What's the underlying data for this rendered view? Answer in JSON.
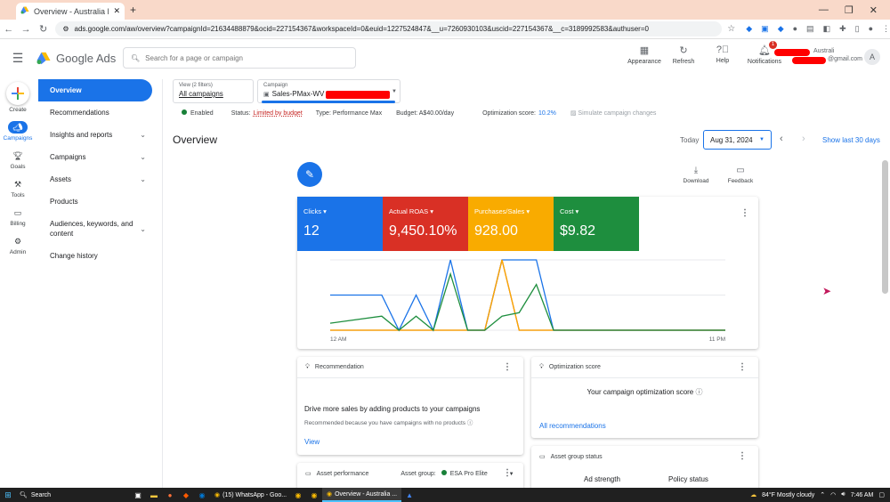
{
  "browser": {
    "tab_title": "Overview - Australia Hoverbo…",
    "url": "ads.google.com/aw/overview?campaignId=21634488879&ocid=227154367&workspaceId=0&euid=1227524847&__u=7260930103&uscid=227154367&__c=3189992583&authuser=0"
  },
  "header": {
    "product": "Google Ads",
    "search_placeholder": "Search for a page or campaign",
    "actions": [
      {
        "label": "Appearance",
        "icon": "appearance-icon"
      },
      {
        "label": "Refresh",
        "icon": "refresh-icon"
      },
      {
        "label": "Help",
        "icon": "help-icon"
      },
      {
        "label": "Notifications",
        "icon": "bell-icon",
        "badge": "1"
      }
    ],
    "account_name": "Australi",
    "account_email": "@gmail.com",
    "avatar_letter": "A"
  },
  "rail": [
    {
      "label": "Create",
      "icon": "plus-icon"
    },
    {
      "label": "Campaigns",
      "icon": "megaphone-icon",
      "active": true
    },
    {
      "label": "Goals",
      "icon": "trophy-icon"
    },
    {
      "label": "Tools",
      "icon": "tools-icon"
    },
    {
      "label": "Billing",
      "icon": "card-icon"
    },
    {
      "label": "Admin",
      "icon": "gear-icon"
    }
  ],
  "sidenav": {
    "overview": "Overview",
    "recommendations": "Recommendations",
    "insights": "Insights and reports",
    "campaigns": "Campaigns",
    "assets": "Assets",
    "products": "Products",
    "audiences": "Audiences, keywords, and content",
    "change_history": "Change history"
  },
  "filters": {
    "view_label": "View (2 filters)",
    "view_value": "All campaigns",
    "campaign_label": "Campaign",
    "campaign_value": "Sales-PMax-WV"
  },
  "status": {
    "enabled": "Enabled",
    "status_label": "Status:",
    "status_value": "Limited by budget",
    "type": "Type: Performance Max",
    "budget": "Budget: A$40.00/day",
    "opt_label": "Optimization score:",
    "opt_value": "10.2%",
    "simulate": "Simulate campaign changes"
  },
  "page": {
    "title": "Overview",
    "today": "Today",
    "date": "Aug 31, 2024",
    "last30": "Show last 30 days",
    "download": "Download",
    "feedback": "Feedback"
  },
  "metrics": [
    {
      "name": "Clicks",
      "value": "12",
      "color": "#1a73e8"
    },
    {
      "name": "Actual ROAS",
      "value": "9,450.10%",
      "color": "#d93025"
    },
    {
      "name": "Purchases/Sales",
      "value": "928.00",
      "color": "#f9ab00"
    },
    {
      "name": "Cost",
      "value": "$9.82",
      "color": "#1e8e3e"
    }
  ],
  "chart_data": {
    "type": "line",
    "x_start_label": "12 AM",
    "x_end_label": "11 PM",
    "x": [
      0,
      3,
      4,
      5,
      6,
      7,
      8,
      9,
      10,
      11,
      12,
      13,
      14,
      15,
      16,
      23
    ],
    "series": [
      {
        "color": "#1a73e8",
        "values": [
          0.5,
          0.5,
          0,
          0.5,
          0,
          1,
          0,
          0,
          1,
          1,
          1,
          0,
          0,
          0,
          0,
          0
        ]
      },
      {
        "color": "#d93025",
        "values": [
          0,
          0,
          0,
          0,
          0,
          0,
          0,
          0,
          1,
          0,
          0,
          0,
          0,
          0,
          0,
          0
        ]
      },
      {
        "color": "#f9ab00",
        "values": [
          0,
          0,
          0,
          0,
          0,
          0,
          0,
          0,
          1,
          0,
          0,
          0,
          0,
          0,
          0,
          0
        ]
      },
      {
        "color": "#1e8e3e",
        "values": [
          0.1,
          0.2,
          0,
          0.2,
          0,
          0.8,
          0,
          0,
          0.2,
          0.25,
          0.65,
          0,
          0,
          0,
          0,
          0
        ]
      }
    ]
  },
  "cards": {
    "recommendation": {
      "title": "Recommendation",
      "headline": "Drive more sales by adding products to your campaigns",
      "sub": "Recommended because you have campaigns with no products",
      "link": "View"
    },
    "optimization": {
      "title": "Optimization score",
      "text": "Your campaign optimization score",
      "link": "All recommendations"
    },
    "asset_performance": {
      "title": "Asset performance",
      "group_label": "Asset group:",
      "group_value": "ESA Pro Elite"
    },
    "asset_group_status": {
      "title": "Asset group status",
      "col1": "Ad strength",
      "col2": "Policy status"
    }
  },
  "taskbar": {
    "search": "Search",
    "apps": [
      "(15) WhatsApp - Goo...",
      "Overview - Australia ..."
    ],
    "weather": "84°F  Mostly cloudy",
    "time": "7:46 AM"
  }
}
